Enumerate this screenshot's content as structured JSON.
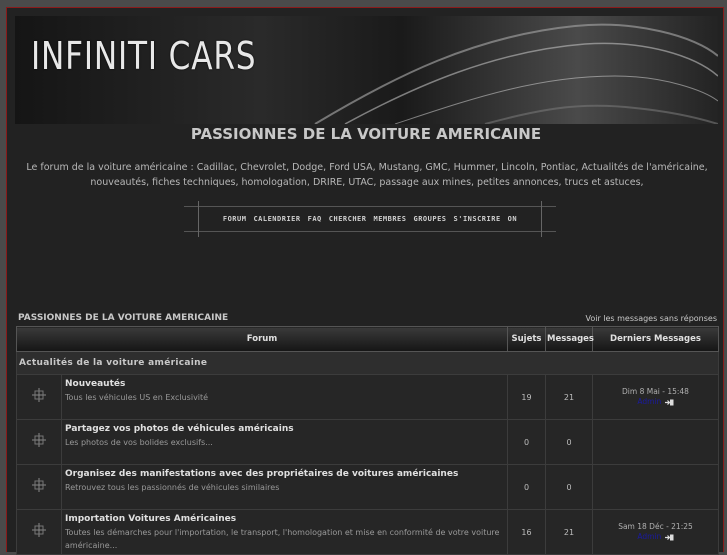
{
  "banner": {
    "logo": "INFINITI CARS"
  },
  "site": {
    "title": "PASSIONNES DE LA VOITURE AMERICAINE",
    "description": "Le forum de la voiture américaine : Cadillac, Chevrolet, Dodge, Ford USA, Mustang, GMC, Hummer, Lincoln, Pontiac, Actualités de l'américaine, nouveautés, fiches techniques, homologation, DRIRE, UTAC, passage aux mines, petites annonces, trucs et astuces,"
  },
  "nav": [
    "forum",
    "calendrier",
    "faq",
    "chercher",
    "membres",
    "groupes",
    "s'inscrire",
    "on"
  ],
  "board": {
    "heading": "PASSIONNES DE LA VOITURE AMERICAINE",
    "unanswered_link": "Voir les messages sans réponses"
  },
  "table": {
    "headers": {
      "forum": "Forum",
      "topics": "Sujets",
      "posts": "Messages",
      "last": "Derniers Messages"
    },
    "category": "Actualités de la voiture américaine",
    "forums": [
      {
        "title": "Nouveautés",
        "desc": "Tous les véhicules US en Exclusivité",
        "topics": "19",
        "posts": "21",
        "last_date": "Dim 8 Mai - 15:48",
        "last_author": "Admin"
      },
      {
        "title": "Partagez vos photos de véhicules américains",
        "desc": "Les photos de vos bolides exclusifs...",
        "topics": "0",
        "posts": "0",
        "last_date": "",
        "last_author": ""
      },
      {
        "title": "Organisez des manifestations avec des propriétaires de voitures américaines",
        "desc": "Retrouvez tous les passionnés de véhicules similaires",
        "topics": "0",
        "posts": "0",
        "last_date": "",
        "last_author": ""
      },
      {
        "title": "Importation Voitures Américaines",
        "desc": "Toutes les démarches pour l'importation, le transport, l'homologation et mise en conformité de votre voiture américaine...",
        "topics": "16",
        "posts": "21",
        "last_date": "Sam 18 Déc - 21:25",
        "last_author": "Admin"
      }
    ]
  }
}
